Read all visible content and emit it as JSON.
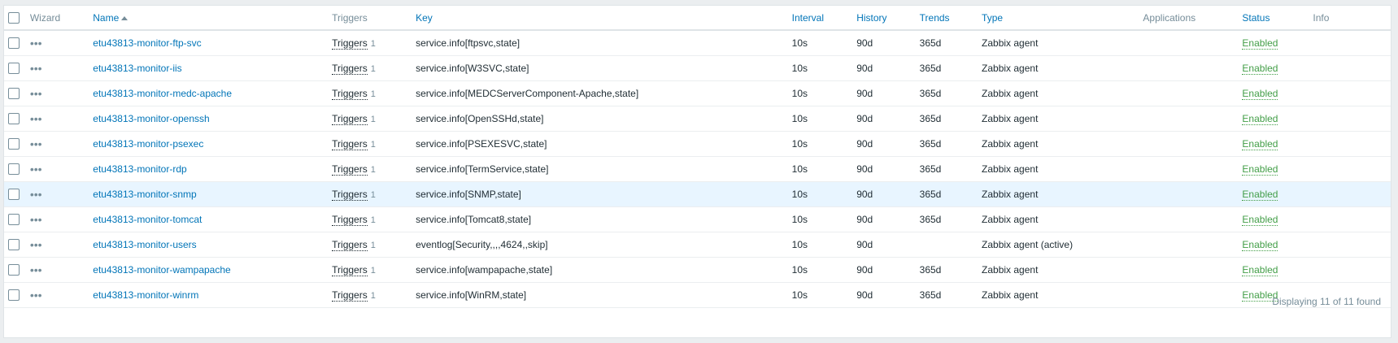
{
  "headers": {
    "wizard": "Wizard",
    "name": "Name",
    "triggers": "Triggers",
    "key": "Key",
    "interval": "Interval",
    "history": "History",
    "trends": "Trends",
    "type": "Type",
    "applications": "Applications",
    "status": "Status",
    "info": "Info"
  },
  "rows": [
    {
      "name": "etu43813-monitor-ftp-svc",
      "triggers": "Triggers",
      "trigger_count": "1",
      "key": "service.info[ftpsvc,state]",
      "interval": "10s",
      "history": "90d",
      "trends": "365d",
      "type": "Zabbix agent",
      "applications": "",
      "status": "Enabled"
    },
    {
      "name": "etu43813-monitor-iis",
      "triggers": "Triggers",
      "trigger_count": "1",
      "key": "service.info[W3SVC,state]",
      "interval": "10s",
      "history": "90d",
      "trends": "365d",
      "type": "Zabbix agent",
      "applications": "",
      "status": "Enabled"
    },
    {
      "name": "etu43813-monitor-medc-apache",
      "triggers": "Triggers",
      "trigger_count": "1",
      "key": "service.info[MEDCServerComponent-Apache,state]",
      "interval": "10s",
      "history": "90d",
      "trends": "365d",
      "type": "Zabbix agent",
      "applications": "",
      "status": "Enabled"
    },
    {
      "name": "etu43813-monitor-openssh",
      "triggers": "Triggers",
      "trigger_count": "1",
      "key": "service.info[OpenSSHd,state]",
      "interval": "10s",
      "history": "90d",
      "trends": "365d",
      "type": "Zabbix agent",
      "applications": "",
      "status": "Enabled"
    },
    {
      "name": "etu43813-monitor-psexec",
      "triggers": "Triggers",
      "trigger_count": "1",
      "key": "service.info[PSEXESVC,state]",
      "interval": "10s",
      "history": "90d",
      "trends": "365d",
      "type": "Zabbix agent",
      "applications": "",
      "status": "Enabled"
    },
    {
      "name": "etu43813-monitor-rdp",
      "triggers": "Triggers",
      "trigger_count": "1",
      "key": "service.info[TermService,state]",
      "interval": "10s",
      "history": "90d",
      "trends": "365d",
      "type": "Zabbix agent",
      "applications": "",
      "status": "Enabled"
    },
    {
      "name": "etu43813-monitor-snmp",
      "triggers": "Triggers",
      "trigger_count": "1",
      "key": "service.info[SNMP,state]",
      "interval": "10s",
      "history": "90d",
      "trends": "365d",
      "type": "Zabbix agent",
      "applications": "",
      "status": "Enabled"
    },
    {
      "name": "etu43813-monitor-tomcat",
      "triggers": "Triggers",
      "trigger_count": "1",
      "key": "service.info[Tomcat8,state]",
      "interval": "10s",
      "history": "90d",
      "trends": "365d",
      "type": "Zabbix agent",
      "applications": "",
      "status": "Enabled"
    },
    {
      "name": "etu43813-monitor-users",
      "triggers": "Triggers",
      "trigger_count": "1",
      "key": "eventlog[Security,,,,4624,,skip]",
      "interval": "10s",
      "history": "90d",
      "trends": "",
      "type": "Zabbix agent (active)",
      "applications": "",
      "status": "Enabled"
    },
    {
      "name": "etu43813-monitor-wampapache",
      "triggers": "Triggers",
      "trigger_count": "1",
      "key": "service.info[wampapache,state]",
      "interval": "10s",
      "history": "90d",
      "trends": "365d",
      "type": "Zabbix agent",
      "applications": "",
      "status": "Enabled"
    },
    {
      "name": "etu43813-monitor-winrm",
      "triggers": "Triggers",
      "trigger_count": "1",
      "key": "service.info[WinRM,state]",
      "interval": "10s",
      "history": "90d",
      "trends": "365d",
      "type": "Zabbix agent",
      "applications": "",
      "status": "Enabled"
    }
  ],
  "highlighted_row": 6,
  "footer": "Displaying 11 of 11 found",
  "icons": {
    "wizard": "ellipsis-icon",
    "sort": "sort-ascending-icon"
  },
  "colors": {
    "link": "#0275b8",
    "enabled": "#429e47",
    "muted": "#768d99",
    "highlight": "#e8f5ff"
  }
}
